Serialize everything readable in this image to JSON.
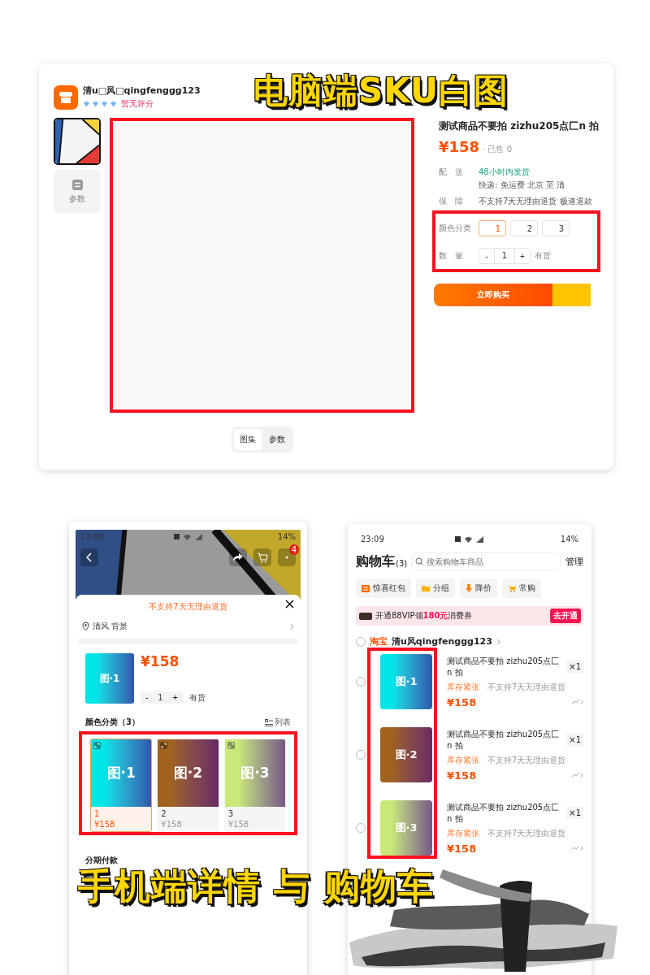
{
  "desktop": {
    "caption": "电脑端SKU白图",
    "shop": {
      "name": "清u□风□qingfenggg123",
      "rating": "暂无评分"
    },
    "side_tabs": [
      {
        "kind": "picture",
        "selected": true
      },
      {
        "kind": "params",
        "label": "参数",
        "selected": false
      }
    ],
    "product_title": "测试商品不要拍 zizhu205点匚n 拍",
    "price": "¥158",
    "sold": "· 已售 0",
    "delivery": {
      "label": "配　送",
      "speed": "48小时内发货",
      "info": "快递: 免运费  北京  至  清"
    },
    "guarantee": {
      "label": "保　障",
      "text": "不支持7天无理由退货 极速退款"
    },
    "sku_label": "颜色分类",
    "sku_options": [
      {
        "label": "1",
        "selected": true
      },
      {
        "label": "2",
        "selected": false
      },
      {
        "label": "3",
        "selected": false
      }
    ],
    "qty_label": "数　量",
    "qty_minus": "-",
    "qty": "1",
    "qty_plus": "+",
    "stock": "有货",
    "buy_button": "立即购买",
    "gallery_tabs": [
      {
        "label": "图集",
        "selected": true
      },
      {
        "label": "参数",
        "selected": false
      }
    ]
  },
  "mobile_detail": {
    "time": "23:08",
    "battery": "14%",
    "cart_badge": "4",
    "notice": "不支持7天无理由退货",
    "address": "清风 背景",
    "thumb": {
      "label": "图·1",
      "color": "#00e6e8"
    },
    "price": "¥158",
    "qty_minus": "-",
    "qty": "1",
    "qty_plus": "+",
    "stock": "有货",
    "section_title": "颜色分类（3）",
    "view_toggle": "列表",
    "options": [
      {
        "image_label": "图·1",
        "name": "1",
        "price": "¥158",
        "selected": true,
        "color": "#00e6e8"
      },
      {
        "image_label": "图·2",
        "name": "2",
        "price": "¥158",
        "selected": false,
        "color": "#a0621e"
      },
      {
        "image_label": "图·3",
        "name": "3",
        "price": "¥158",
        "selected": false,
        "color": "#c8e878"
      }
    ],
    "installments": "分期付款"
  },
  "cart": {
    "time": "23:09",
    "battery": "14%",
    "title": "购物车",
    "count": "(3)",
    "search": {
      "placeholder": "搜索购物车商品"
    },
    "manage": "管理",
    "chips": [
      {
        "kind": "coupon",
        "label": "惊喜红包"
      },
      {
        "kind": "folder",
        "label": "分组"
      },
      {
        "kind": "down",
        "label": "降价"
      },
      {
        "kind": "cart",
        "label": "常购"
      }
    ],
    "vip": {
      "text": "开通88VIP领**180元**消费券",
      "button": "去开通"
    },
    "shop": {
      "platform": "淘宝",
      "name": "清u风qingfenggg123",
      "checked": false
    },
    "items": [
      {
        "image_label": "图·1",
        "color": "#00e6e8",
        "title": "测试商品不要拍 zizhu205点匚n 拍",
        "qty": "×1",
        "stock": "库存紧张",
        "policy": "不支持7天无理由退货",
        "price": "¥158",
        "checked": false
      },
      {
        "image_label": "图·2",
        "color": "#a0621e",
        "title": "测试商品不要拍 zizhu205点匚n 拍",
        "qty": "×1",
        "stock": "库存紧张",
        "policy": "不支持7天无理由退货",
        "price": "¥158",
        "checked": false
      },
      {
        "image_label": "图·3",
        "color": "#c8e878",
        "title": "测试商品不要拍 zizhu205点匚n 拍",
        "qty": "×1",
        "stock": "库存紧张",
        "policy": "不支持7天无理由退货",
        "price": "¥158",
        "checked": false
      }
    ]
  },
  "caption": "手机端详情 与 购物车"
}
